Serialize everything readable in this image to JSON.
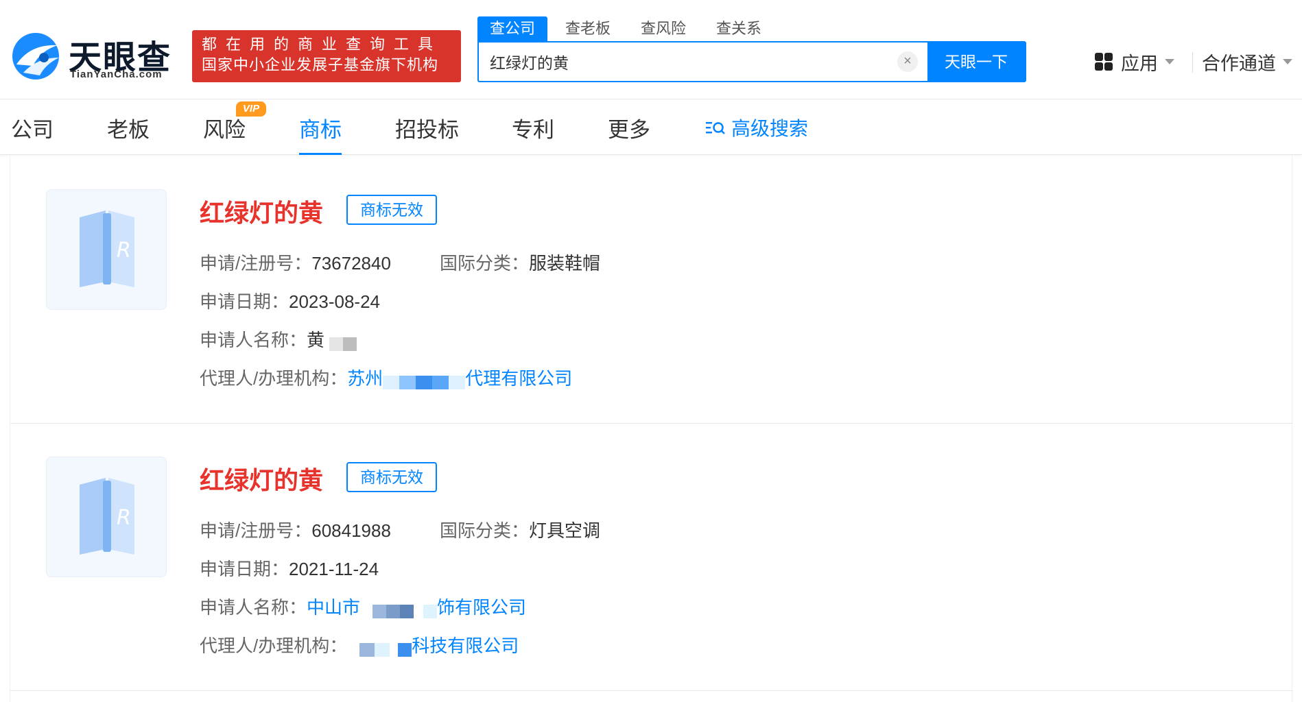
{
  "brand": {
    "name": "天眼查",
    "url": "TianYanCha.com",
    "primary_color": "#0084ff",
    "accent_color": "#d9342b"
  },
  "slogan": {
    "line1": "都在用的商业查询工具",
    "line2": "国家中小企业发展子基金旗下机构"
  },
  "search": {
    "tabs": [
      "查公司",
      "查老板",
      "查风险",
      "查关系"
    ],
    "value": "红绿灯的黄",
    "clear_icon": "×",
    "button": "天眼一下"
  },
  "header_right": {
    "apps": "应用",
    "cooperation": "合作通道"
  },
  "nav": {
    "items": [
      "公司",
      "老板",
      "风险",
      "商标",
      "招投标",
      "专利",
      "更多"
    ],
    "active": "商标",
    "vip": "VIP",
    "advanced_search": "高级搜索"
  },
  "results": [
    {
      "title": "红绿灯的黄",
      "status": "商标无效",
      "reg_label": "申请/注册号：",
      "reg_no": "73672840",
      "class_label": "国际分类：",
      "class": "服装鞋帽",
      "date_label": "申请日期：",
      "date": "2023-08-24",
      "applicant_label": "申请人名称：",
      "applicant_prefix": "黄",
      "applicant_suffix": "",
      "agent_label": "代理人/办理机构：",
      "agent_prefix": "苏州",
      "agent_suffix": "代理有限公司"
    },
    {
      "title": "红绿灯的黄",
      "status": "商标无效",
      "reg_label": "申请/注册号：",
      "reg_no": "60841988",
      "class_label": "国际分类：",
      "class": "灯具空调",
      "date_label": "申请日期：",
      "date": "2021-11-24",
      "applicant_label": "申请人名称：",
      "applicant_prefix": "中山市",
      "applicant_suffix": "饰有限公司",
      "agent_label": "代理人/办理机构：",
      "agent_prefix": "",
      "agent_suffix": "科技有限公司"
    }
  ]
}
